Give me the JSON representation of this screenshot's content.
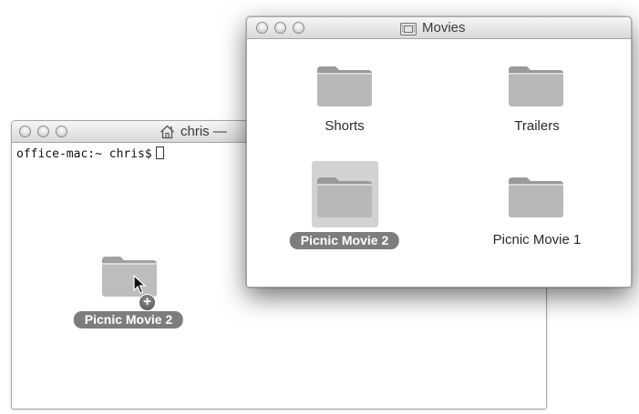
{
  "terminal": {
    "title": "chris —",
    "prompt": "office-mac:~ chris$"
  },
  "finder": {
    "title": "Movies",
    "items": [
      {
        "label": "Shorts",
        "selected": false
      },
      {
        "label": "Trailers",
        "selected": false
      },
      {
        "label": "Picnic Movie 2",
        "selected": true
      },
      {
        "label": "Picnic Movie 1",
        "selected": false
      }
    ]
  },
  "drag": {
    "label": "Picnic Movie 2",
    "badge": "+"
  },
  "icons": {
    "close": "traffic-light-close",
    "minimize": "traffic-light-minimize",
    "zoom": "traffic-light-zoom",
    "home": "home-icon",
    "folder": "folder-icon",
    "pointer": "arrow-pointer-icon",
    "copy_badge": "plus-badge-icon"
  },
  "colors": {
    "selection_pill": "#7d7d7d",
    "selection_box": "#d2d2d2",
    "titlebar_top": "#f6f6f6",
    "titlebar_bottom": "#d9d9d9"
  }
}
